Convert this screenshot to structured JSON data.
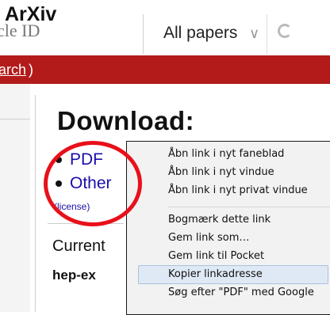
{
  "caption": "ArXiv",
  "search": {
    "value": "cle ID",
    "scope_selected": "All papers"
  },
  "banner": {
    "link_text": "arch",
    "link_suffix": ")"
  },
  "main": {
    "download_title": "Download:",
    "links": [
      "PDF",
      "Other"
    ],
    "license": "(license)",
    "current_label": "Current",
    "category": "hep-ex"
  },
  "context_menu": {
    "groups": [
      [
        "Åbn link i nyt faneblad",
        "Åbn link i nyt vindue",
        "Åbn link i nyt privat vindue"
      ],
      [
        "Bogmærk dette link",
        "Gem link som…",
        "Gem link til Pocket",
        "Kopier linkadresse",
        "Søg efter \"PDF\" med Google"
      ]
    ],
    "highlighted": "Kopier linkadresse"
  },
  "colors": {
    "arxiv_red": "#b31b1b",
    "annotation_red": "#e8101a",
    "link_blue": "#1a0dab",
    "menu_highlight": "#dfe9f5"
  }
}
